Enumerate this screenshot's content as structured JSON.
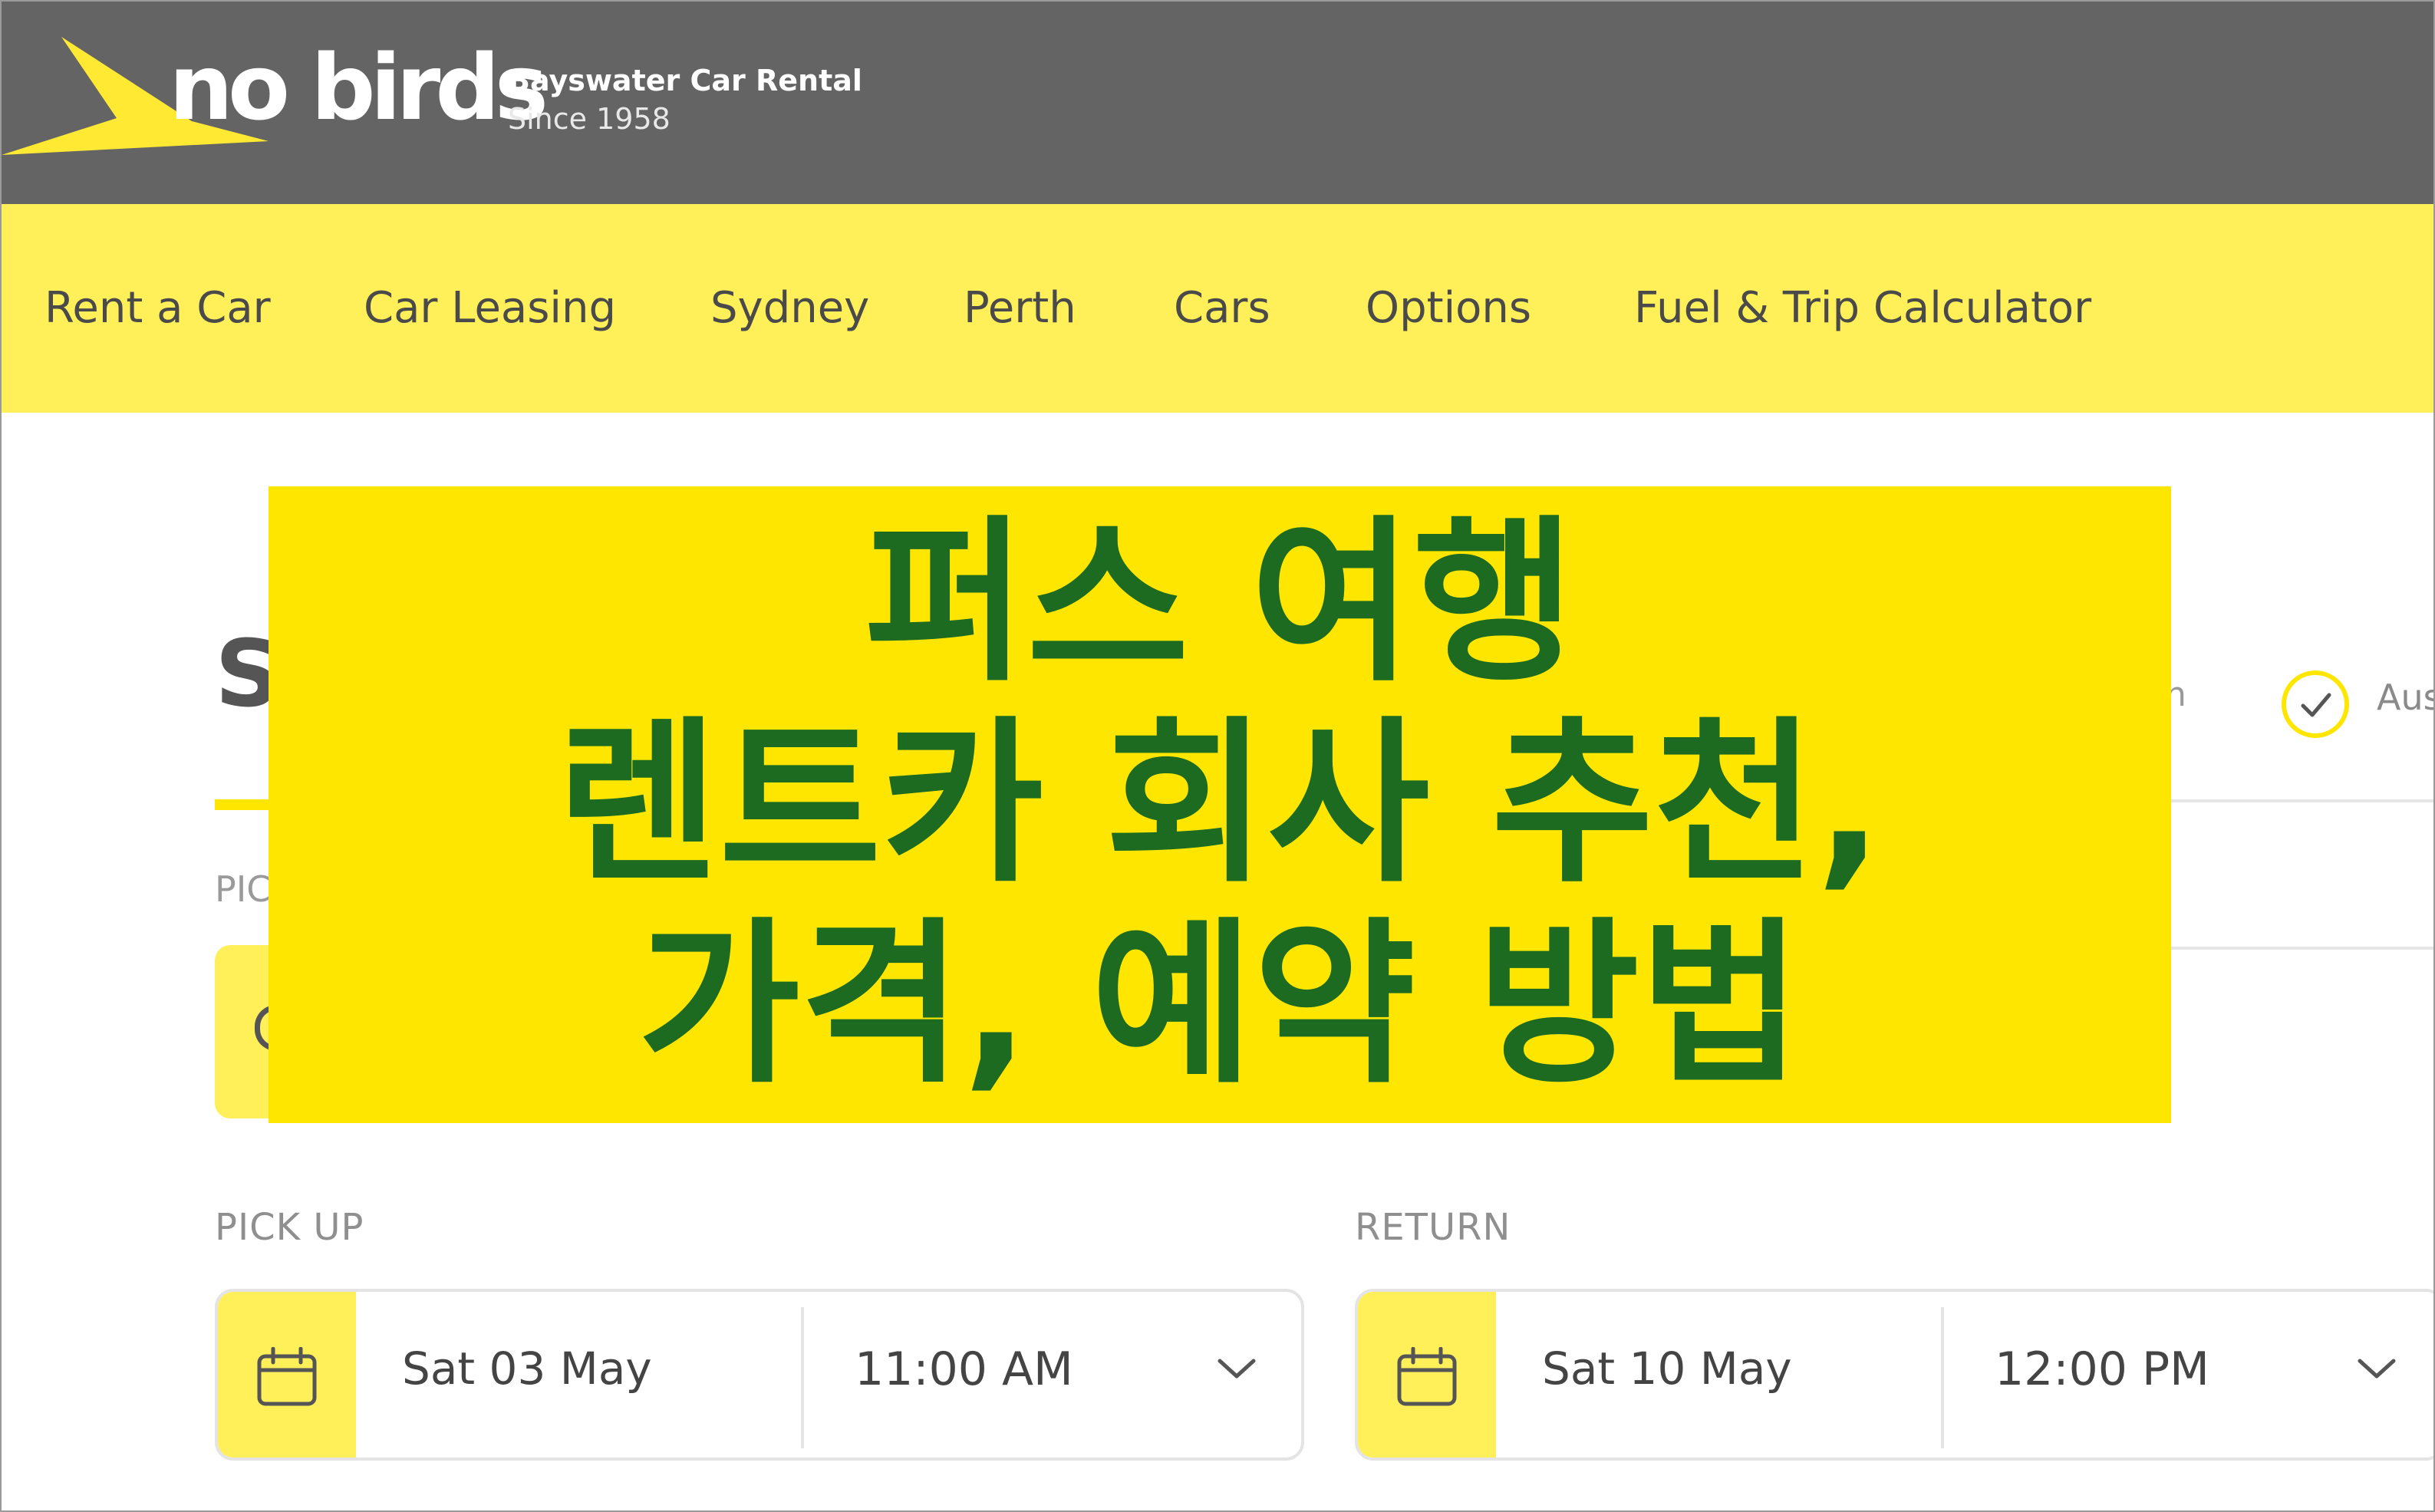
{
  "header": {
    "logo_text": "no birds",
    "tagline_line1": "Bayswater Car Rental",
    "tagline_line2": "Since 1958",
    "background": "#646464",
    "logo_color": "#ffe933"
  },
  "nav": {
    "background": "#fff05a",
    "items": [
      {
        "label": "Rent a Car"
      },
      {
        "label": "Car Leasing"
      },
      {
        "label": "Sydney"
      },
      {
        "label": "Perth"
      },
      {
        "label": "Cars"
      },
      {
        "label": "Options"
      },
      {
        "label": "Fuel & Trip Calculator"
      }
    ]
  },
  "search": {
    "title_partial": "S",
    "pickup_location_label_partial": "PIC",
    "right_partial": "n",
    "check_text_partial": "Aus"
  },
  "overlay": {
    "line1": "퍼스 여행",
    "line2": "렌트카 회사 추천,",
    "line3": "가격, 예약 방법",
    "background": "#ffe600",
    "text_color": "#1c6b21"
  },
  "pickup": {
    "label": "PICK UP",
    "date": "Sat 03 May",
    "time": "11:00 AM",
    "icon": "calendar-icon"
  },
  "return": {
    "label": "RETURN",
    "date": "Sat 10 May",
    "time": "12:00 PM",
    "icon": "calendar-icon"
  }
}
